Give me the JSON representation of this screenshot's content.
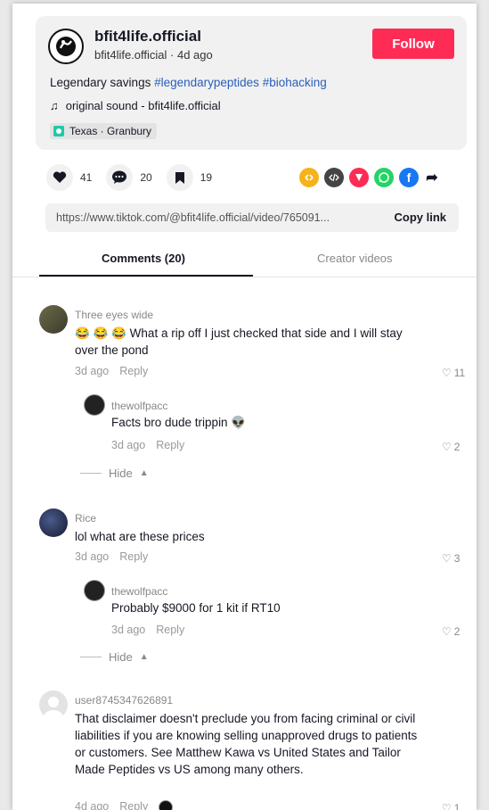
{
  "post": {
    "username": "bfit4life.official",
    "subline": "bfit4life.official · 4d ago",
    "follow_label": "Follow",
    "description_text": "Legendary savings ",
    "hashtag1": "#legendarypeptides",
    "hashtag2": "#biohacking",
    "sound": "original sound - bfit4life.official",
    "location": "Texas · Granbury"
  },
  "actions": {
    "likes": "41",
    "comments": "20",
    "saves": "19"
  },
  "share": {
    "link": "https://www.tiktok.com/@bfit4life.official/video/765091...",
    "copy_label": "Copy link",
    "icons": [
      "embed-icon",
      "code-icon",
      "send-icon",
      "whatsapp-icon",
      "facebook-icon",
      "share-arrow-icon"
    ],
    "colors": [
      "#f5b21b",
      "#444444",
      "#fe2c55",
      "#25d366",
      "#1877f2"
    ]
  },
  "tabs": {
    "comments": "Comments (20)",
    "creator": "Creator videos"
  },
  "comments": [
    {
      "name": "Three eyes wide",
      "text": "😂 😂 😂 What a rip off I just checked that side and I will stay over the pond",
      "time": "3d ago",
      "reply": "Reply",
      "likes": "11",
      "replies": [
        {
          "name": "thewolfpacc",
          "text": "Facts bro dude trippin 👽",
          "time": "3d ago",
          "reply": "Reply",
          "likes": "2"
        }
      ],
      "hide": "Hide"
    },
    {
      "name": "Rice",
      "text": "lol what are these prices",
      "time": "3d ago",
      "reply": "Reply",
      "likes": "3",
      "replies": [
        {
          "name": "thewolfpacc",
          "text": "Probably $9000 for 1 kit if RT10",
          "time": "3d ago",
          "reply": "Reply",
          "likes": "2"
        }
      ],
      "hide": "Hide"
    },
    {
      "name": "user8745347626891",
      "text": "That disclaimer doesn't preclude you from facing criminal or civil liabilities if you are knowing selling unapproved drugs to patients or customers. See Matthew Kawa vs United States and Tailor Made Peptides vs US among many others.",
      "time": "4d ago",
      "reply": "Reply",
      "likes": "1"
    }
  ]
}
